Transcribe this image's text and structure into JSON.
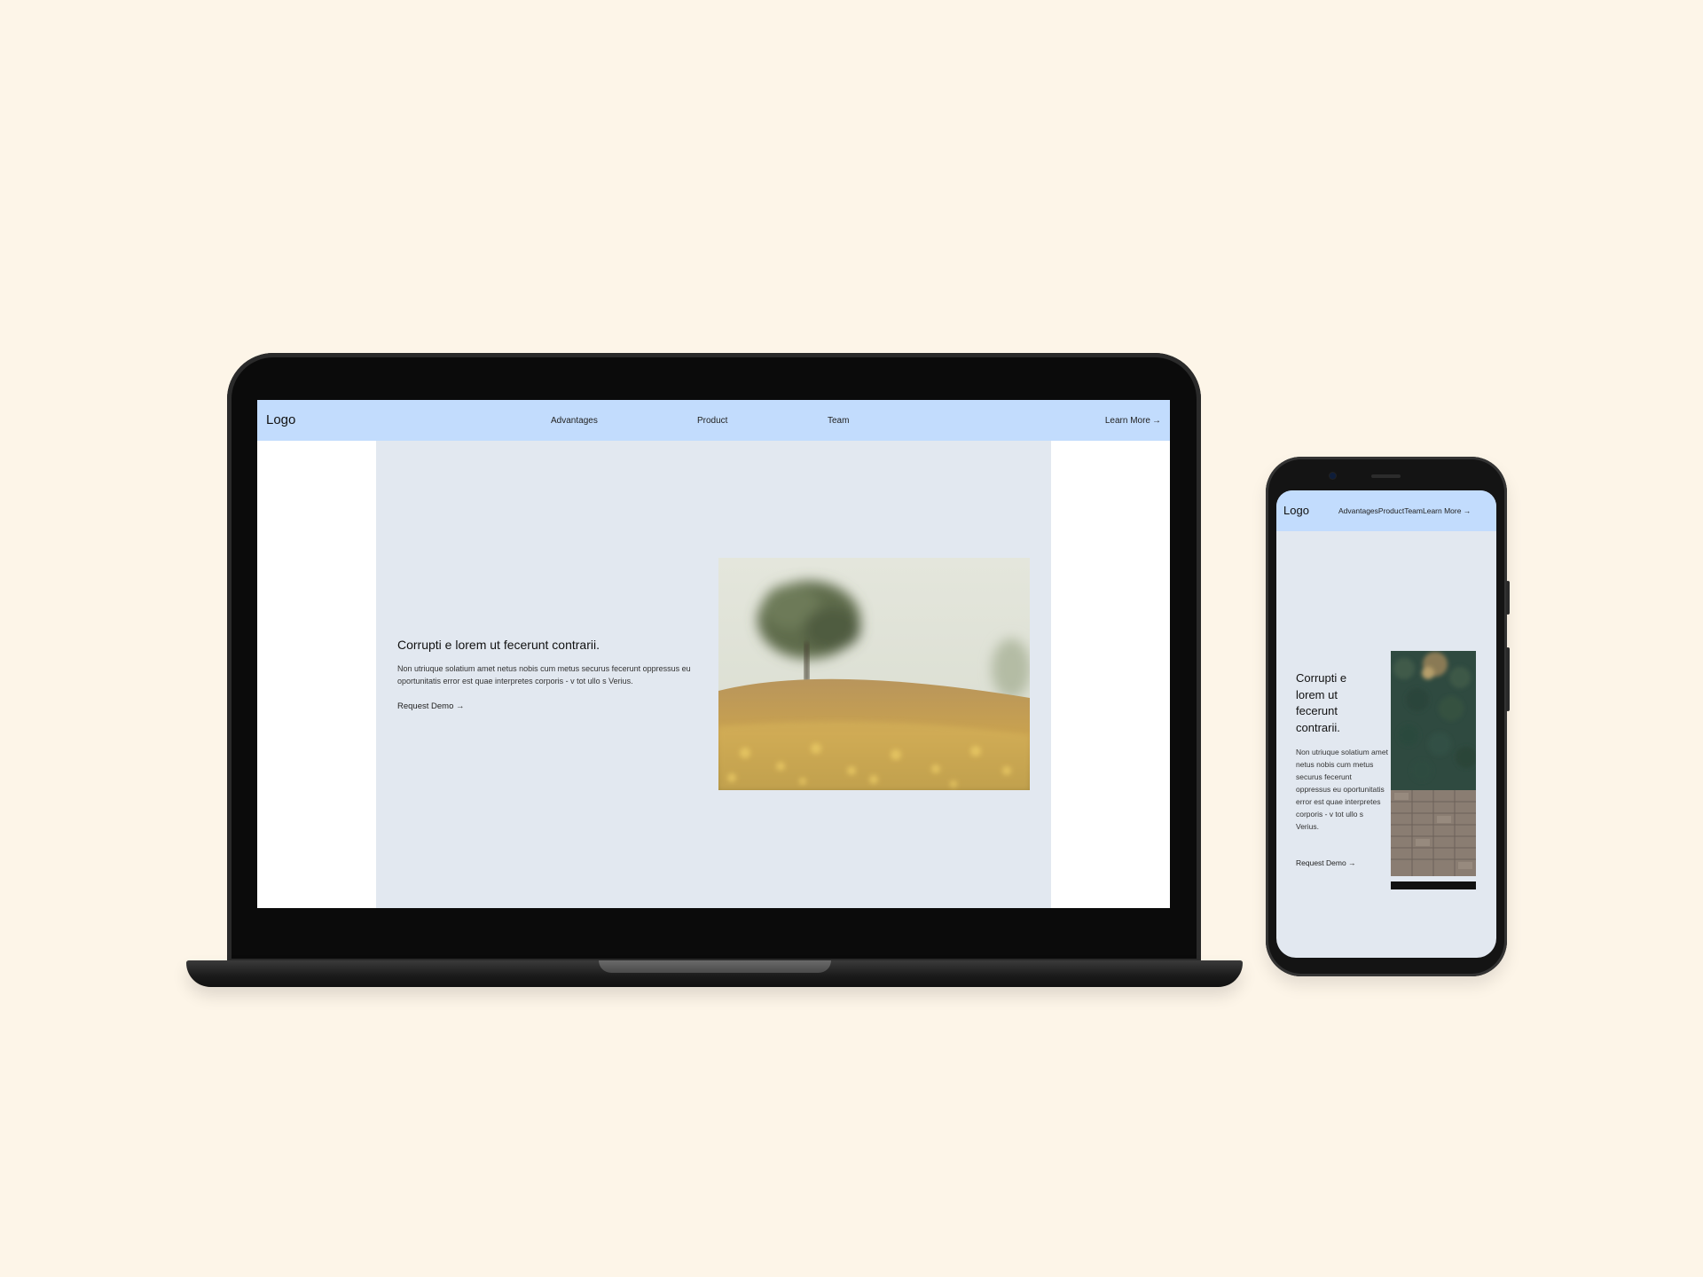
{
  "desktop": {
    "nav": {
      "logo": "Logo",
      "links": [
        "Advantages",
        "Product",
        "Team"
      ],
      "cta": "Learn More",
      "cta_arrow": "→"
    },
    "hero": {
      "title": "Corrupti e lorem ut fecerunt contrarii.",
      "body": "Non utriuque solatium amet netus nobis cum metus securus fecerunt oppressus eu oportunitatis error est quae interpretes corporis - v tot ullo s Verius.",
      "cta": "Request Demo",
      "cta_arrow": "→",
      "image": "tree-field-photo"
    }
  },
  "mobile": {
    "nav": {
      "logo": "Logo",
      "links": [
        "Advantages",
        "Product",
        "Team"
      ],
      "cta": "Learn More",
      "cta_arrow": "→"
    },
    "hero": {
      "title": "Corrupti e lorem ut fecerunt contrarii.",
      "body": "Non utriuque solatium amet netus nobis cum metus securus fecerunt oppressus eu oportunitatis error est quae interpretes corporis - v tot ullo s Verius.",
      "cta": "Request Demo",
      "cta_arrow": "→",
      "image": "aerial-forest-photo"
    }
  },
  "colors": {
    "backdrop": "#fdf5e8",
    "nav_bg": "#c2dcfd",
    "hero_bg": "#e2e8f0",
    "device": "#0b0b0b"
  }
}
